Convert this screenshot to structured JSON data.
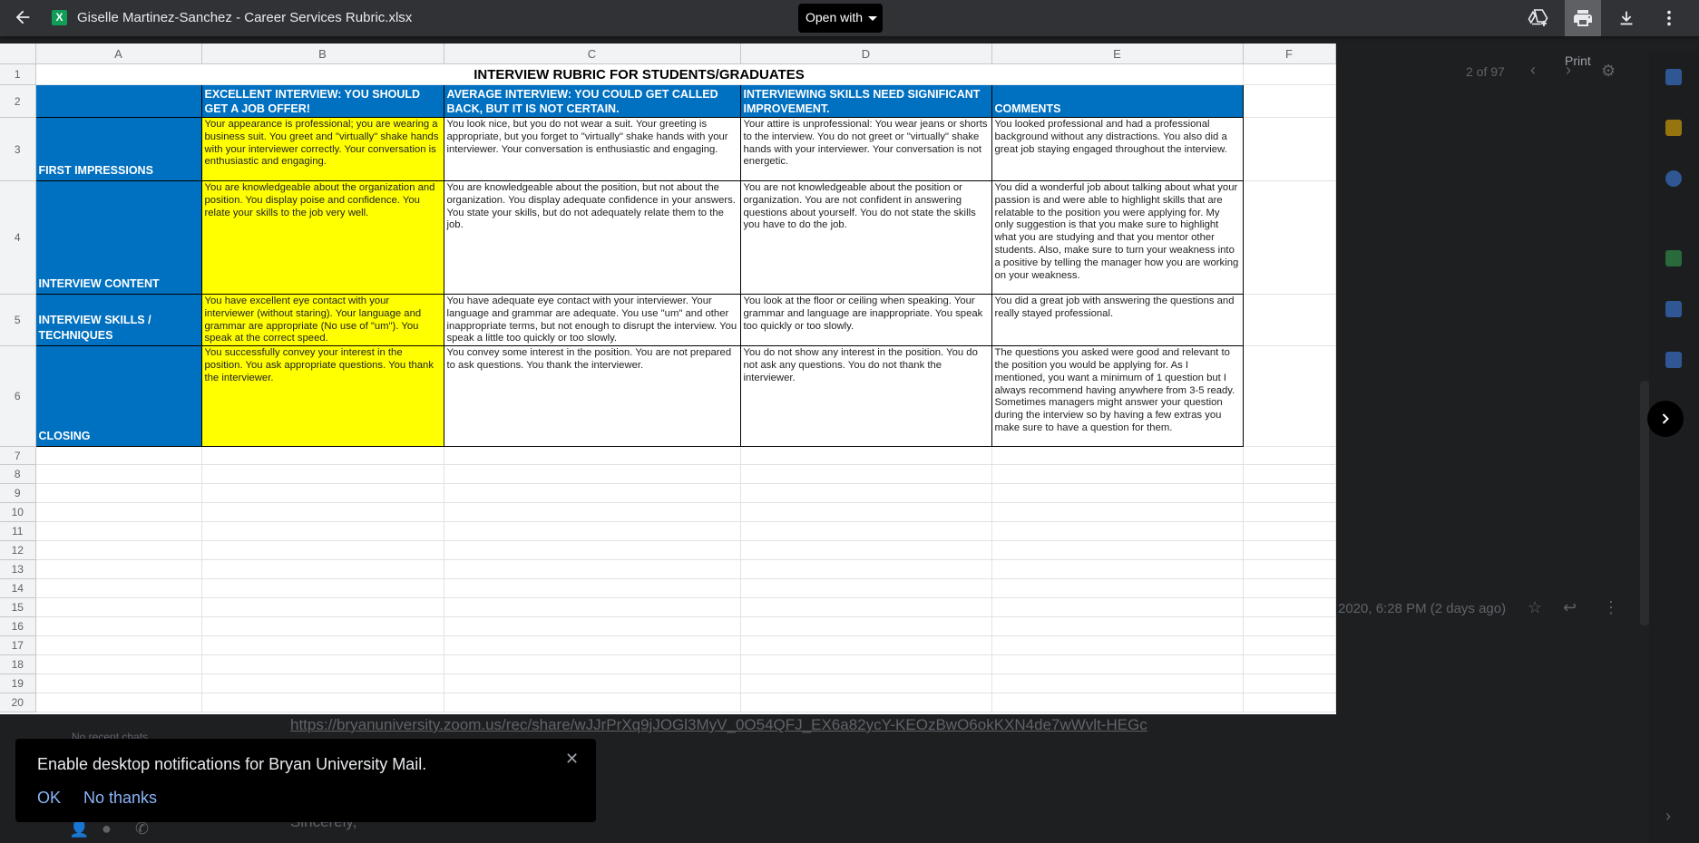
{
  "header": {
    "file_title": "Giselle Martinez-Sanchez - Career Services Rubric.xlsx",
    "open_with": "Open with",
    "print_tooltip": "Print"
  },
  "background": {
    "pager": "2 of 97",
    "date": "2020, 6:28 PM (2 days ago)",
    "link": "https://bryanuniversity.zoom.us/rec/share/wJJrPrXq9jJOGl3MyV_0O54QFJ_EX6a82ycY-KEOzBwO6okKXN4de7wWvlt-HEGc",
    "no_chats": "No recent chats",
    "signoff": "Sincerely,"
  },
  "sheet": {
    "columns": [
      "A",
      "B",
      "C",
      "D",
      "E",
      "F"
    ],
    "rows": [
      "1",
      "2",
      "3",
      "4",
      "5",
      "6",
      "7",
      "8",
      "9",
      "10",
      "11",
      "12",
      "13",
      "14",
      "15",
      "16",
      "17",
      "18",
      "19",
      "20"
    ],
    "title": "INTERVIEW RUBRIC FOR STUDENTS/GRADUATES",
    "headers": {
      "b": "EXCELLENT INTERVIEW: YOU SHOULD GET A JOB OFFER!",
      "c": "AVERAGE INTERVIEW: YOU COULD GET CALLED BACK, BUT IT IS NOT CERTAIN.",
      "d": "INTERVIEWING SKILLS NEED SIGNIFICANT IMPROVEMENT.",
      "e": "COMMENTS"
    },
    "r3": {
      "a": "FIRST IMPRESSIONS",
      "b": "Your appearance is professional; you are wearing a business suit. You greet and \"virtually\" shake hands with your interviewer correctly. Your conversation is enthusiastic and engaging.",
      "c": "You look nice, but you do not wear a suit. Your greeting is appropriate, but you forget to \"virtually\" shake hands with your interviewer. Your conversation is enthusiastic and engaging.",
      "d": "Your attire is unprofessional: You wear jeans or shorts to the interview. You do not greet or \"virtually\" shake hands with your interviewer. Your conversation is not energetic.",
      "e": "You looked professional and had a professional background without any distractions. You also did a great job staying engaged throughout the interview."
    },
    "r4": {
      "a": "INTERVIEW CONTENT",
      "b": "You are knowledgeable about the organization and position. You display poise and confidence. You relate your skills to the job very well.",
      "c": "You are knowledgeable about the position, but not about the organization. You display adequate confidence in your answers. You state your skills, but do not adequately relate them to the job.",
      "d": "You are not knowledgeable about the position or organization. You are not confident in answering questions about yourself. You do not state the skills you have to do the job.",
      "e": "You did a wonderful job about talking about what your passion is and were able to highlight skills that are relatable to the position you were applying for. My only suggestion is that you make sure to highlight what you are studying and that you mentor other students. Also, make sure to turn your weakness into a positive by telling the manager how you are working on your weakness."
    },
    "r5": {
      "a": "INTERVIEW SKILLS / TECHNIQUES",
      "b": "You have excellent eye contact with your interviewer (without staring). Your language and grammar are appropriate (No use of \"um\"). You speak at the correct speed.",
      "c": "You have adequate eye contact with your interviewer. Your language and grammar are adequate. You use \"um\" and other inappropriate terms, but not enough to disrupt the interview. You speak a little too quickly or too slowly.",
      "d": "You look at the floor or ceiling when speaking. Your grammar and language are inappropriate. You speak too quickly or too slowly.",
      "e": "You did a great job with answering the questions and really stayed professional."
    },
    "r6": {
      "a": "CLOSING",
      "b": "You successfully convey your interest in the position. You ask appropriate questions. You thank the interviewer.",
      "c": "You convey some interest in the position. You are not prepared to ask questions. You thank the interviewer.",
      "d": "You do not show any interest in the position. You do not ask any questions. You do not thank the interviewer.",
      "e": "The questions you asked were good and relevant to the position you would be applying for. As I mentioned, you want a minimum of 1 question but I always recommend having anywhere from 3-5 ready. Sometimes managers might answer your question during the interview so by having a few extras you make sure to have a question for them."
    }
  },
  "snackbar": {
    "message": "Enable desktop notifications for Bryan University Mail.",
    "ok": "OK",
    "no_thanks": "No thanks"
  },
  "colors": {
    "header_blue": "#0070c0",
    "highlight_yellow": "#ffff00",
    "topbar": "#313235"
  }
}
